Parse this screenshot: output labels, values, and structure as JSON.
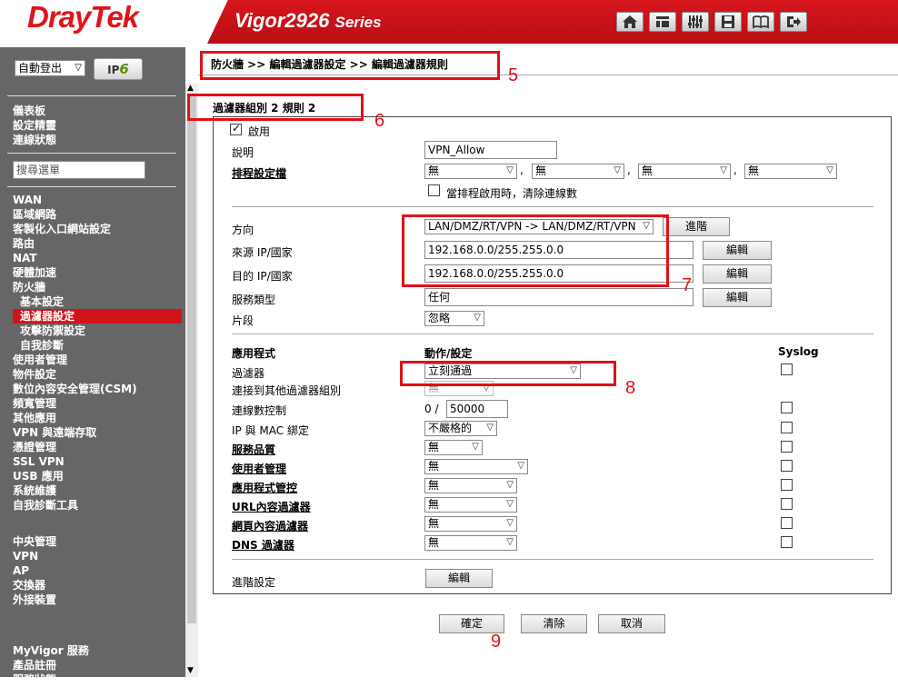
{
  "header": {
    "brand": "DrayTek",
    "model": "Vigor2926",
    "series": "Series",
    "icons": [
      "home-icon",
      "quick-start-icon",
      "mixer-icon",
      "save-icon",
      "manual-icon",
      "logout-icon"
    ]
  },
  "sidebar": {
    "login_mode": "自動登出",
    "ipv6": "IPv6",
    "search_placeholder": "搜尋選單",
    "group1": [
      "儀表板",
      "設定精靈",
      "連線狀態"
    ],
    "group2": [
      "WAN",
      "區域網路",
      "客製化入口網站設定",
      "路由",
      "NAT",
      "硬體加速",
      "防火牆"
    ],
    "firewall_sub": [
      "基本設定",
      "過濾器設定",
      "攻擊防禦設定",
      "自我診斷"
    ],
    "group3": [
      "使用者管理",
      "物件設定",
      "數位內容安全管理(CSM)",
      "頻寬管理",
      "其他應用",
      "VPN 與遠端存取",
      "憑證管理",
      "SSL VPN",
      "USB 應用",
      "系統維護",
      "自我診斷工具"
    ],
    "group4": [
      "中央管理",
      "VPN",
      "AP",
      "交換器",
      "外接裝置"
    ],
    "group5": [
      "MyVigor 服務",
      "產品註冊",
      "服務狀態"
    ]
  },
  "breadcrumb": "防火牆 >> 編輯過濾器設定 >> 編輯過濾器規則",
  "group_title": "過濾器組別 2 規則 2",
  "form": {
    "enable_label": "啟用",
    "comment_label": "說明",
    "comment_value": "VPN_Allow",
    "schedule_label": "排程設定檔",
    "schedule_values": [
      "無",
      "無",
      "無",
      "無"
    ],
    "clear_sessions_label": "當排程啟用時，清除連線數",
    "direction_label": "方向",
    "direction_value": "LAN/DMZ/RT/VPN -> LAN/DMZ/RT/VPN",
    "advanced_btn": "進階",
    "src_label": "來源 IP/國家",
    "src_value": "192.168.0.0/255.255.0.0",
    "dst_label": "目的 IP/國家",
    "dst_value": "192.168.0.0/255.255.0.0",
    "svc_label": "服務類型",
    "svc_value": "任何",
    "edit_btn": "編輯",
    "frag_label": "片段",
    "frag_value": "忽略",
    "app_header": "應用程式",
    "action_header": "動作/設定",
    "syslog_header": "Syslog",
    "filter_label": "過濾器",
    "filter_value": "立刻通過",
    "branch_label": "連接到其他過濾器組別",
    "branch_value": "無",
    "maxconn_label": "連線數控制",
    "maxconn_current": "0 /",
    "maxconn_value": "50000",
    "ipmac_label": "IP 與 MAC 綁定",
    "ipmac_value": "不嚴格的",
    "qos_label": "服務品質",
    "qos_value": "無",
    "user_label": "使用者管理",
    "user_value": "無",
    "apm_label": "應用程式管控",
    "apm_value": "無",
    "url_label": "URL內容過濾器",
    "url_value": "無",
    "web_label": "網頁內容過濾器",
    "web_value": "無",
    "dns_label": "DNS 過濾器",
    "dns_value": "無",
    "adv_label": "進階設定",
    "adv_btn": "編輯"
  },
  "buttons": {
    "ok": "確定",
    "clear": "清除",
    "cancel": "取消"
  },
  "annotations": {
    "n5": "5",
    "n6": "6",
    "n7": "7",
    "n8": "8",
    "n9": "9",
    "color": "#e01018"
  }
}
